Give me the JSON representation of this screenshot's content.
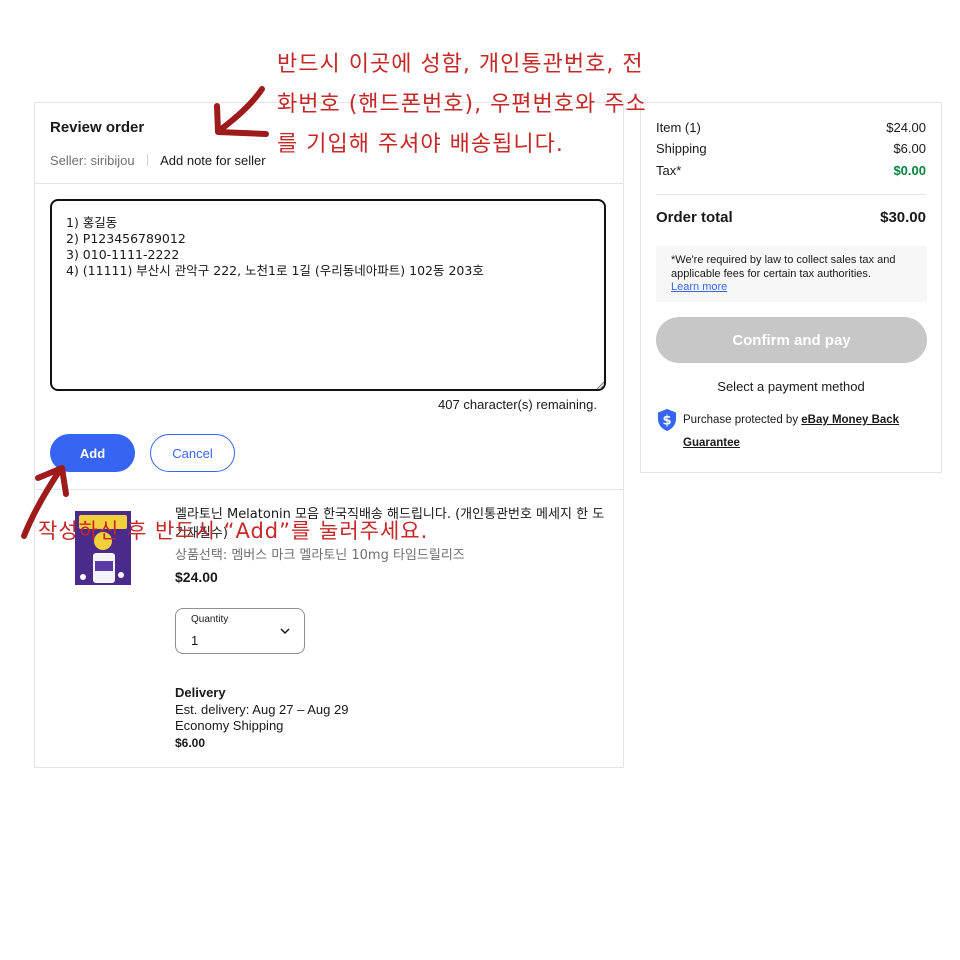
{
  "review": {
    "title": "Review order",
    "seller_label": "Seller:",
    "seller_name": "siribijou",
    "add_note_link": "Add note for seller"
  },
  "note": {
    "text": "1) 홍길동\n2) P123456789012\n3) 010-1111-2222\n4) (11111) 부산시 관악구 222, 노천1로 1길 (우리동네아파트) 102동 203호",
    "remaining": "407 character(s) remaining.",
    "add_button": "Add",
    "cancel_button": "Cancel"
  },
  "item": {
    "title": "멜라토닌 Melatonin 모음 한국직배송 해드립니다. (개인통관번호 메세지 한 도 기재필수)",
    "variant": "상품선택: 멤버스 마크 멜라토닌 10mg 타임드릴리즈",
    "price": "$24.00",
    "quantity_label": "Quantity",
    "quantity_value": "1"
  },
  "delivery": {
    "heading": "Delivery",
    "estimate": "Est. delivery: Aug 27 – Aug 29",
    "method": "Economy Shipping",
    "cost": "$6.00"
  },
  "summary": {
    "rows": [
      {
        "label": "Item (1)",
        "value": "$24.00"
      },
      {
        "label": "Shipping",
        "value": "$6.00"
      },
      {
        "label": "Tax*",
        "value": "$0.00"
      }
    ],
    "total_label": "Order total",
    "total_value": "$30.00",
    "notice": "*We're required by law to collect sales tax and applicable fees for certain tax authorities.",
    "learn_more": "Learn more",
    "confirm_button": "Confirm and pay",
    "payment_method": "Select a payment method",
    "protect_prefix": "Purchase protected by ",
    "protect_link": "eBay Money Back Guarantee"
  },
  "annotations": {
    "top": "반드시 이곳에 성함, 개인통관번호, 전화번호 (핸드폰번호), 우편번호와 주소를 기입해 주셔야 배송됩니다.",
    "bottom": "작성하신 후 반드시 “Add”를 눌러주세요."
  },
  "colors": {
    "accent": "#3665f3",
    "annotation": "#c62828",
    "tax_green": "#05823f",
    "disabled_button": "#c7c7c7"
  },
  "icons": [
    "shield-dollar-icon",
    "chevron-down-icon",
    "resize-grip-icon",
    "annotation-arrow-icon"
  ]
}
